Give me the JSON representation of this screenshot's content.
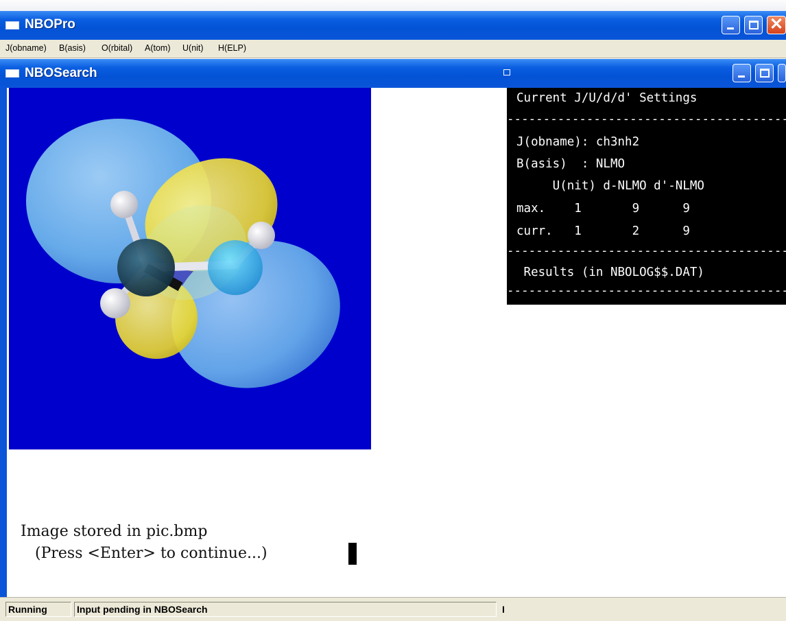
{
  "app": {
    "title": "NBOPro"
  },
  "menu": [
    {
      "label": "J(obname)"
    },
    {
      "label": "B(asis)"
    },
    {
      "label": "O(rbital)"
    },
    {
      "label": "A(tom)"
    },
    {
      "label": "U(nit)"
    },
    {
      "label": "H(ELP)"
    }
  ],
  "child_window": {
    "title": "NBOSearch"
  },
  "settings_panel": {
    "header": "Current J/U/d/d' Settings",
    "divider": "-----------------------------------------",
    "jobname_line": "J(obname): ch3nh2",
    "basis_line": "B(asis)  : NLMO",
    "columns_line": "     U(nit) d-NLMO d'-NLMO",
    "max_line": "max.    1       9      9",
    "curr_line": "curr.   1       2      9",
    "results_line": " Results (in NBOLOG$$.DAT)"
  },
  "console": {
    "line1": "Image stored in pic.bmp",
    "line2": "   (Press <Enter> to continue...)"
  },
  "status": {
    "state": "Running",
    "message": "Input pending in NBOSearch",
    "marker": "I"
  },
  "colors": {
    "titlebar": "#0a55d8",
    "viewport_bg": "#0000cc",
    "orbital_blue": "#7fc4ee",
    "orbital_yellow": "#f0e040"
  }
}
